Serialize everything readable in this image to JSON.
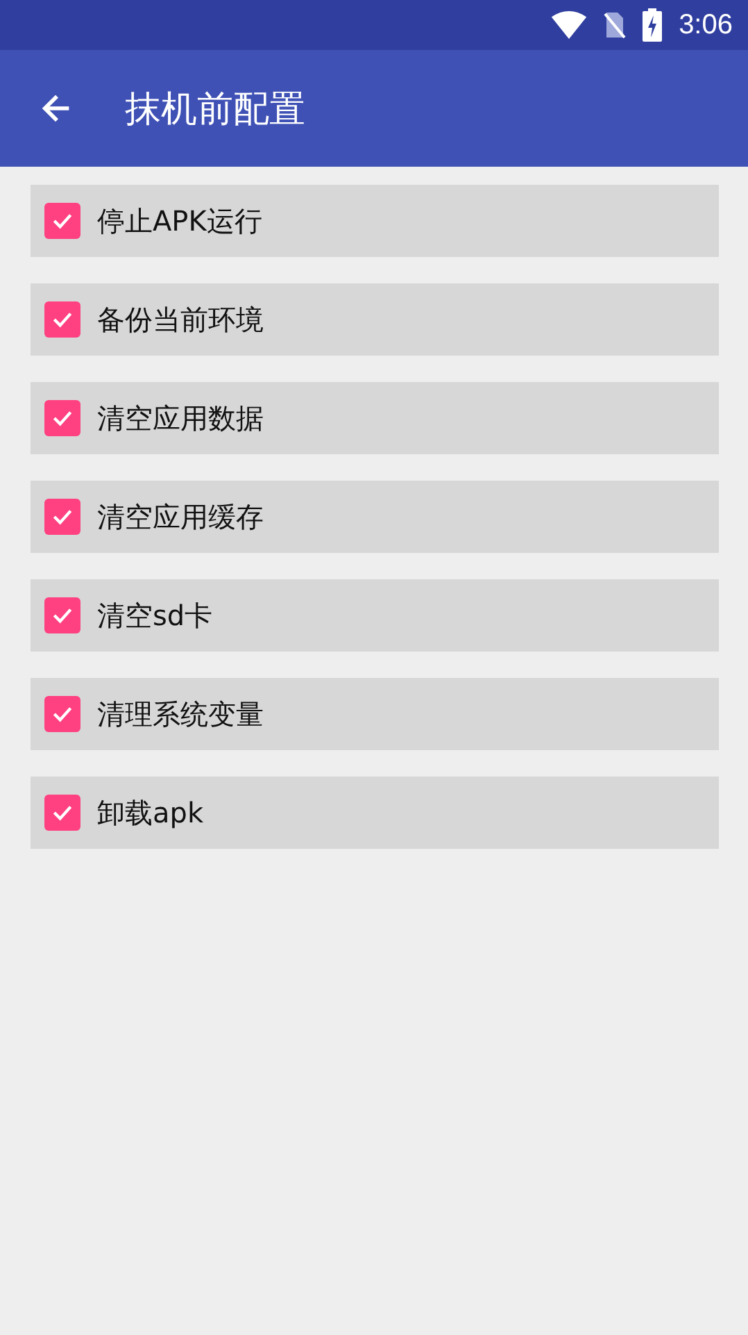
{
  "status_bar": {
    "time": "3:06"
  },
  "app_bar": {
    "title": "抹机前配置"
  },
  "options": [
    {
      "label": "停止APK运行",
      "checked": true
    },
    {
      "label": "备份当前环境",
      "checked": true
    },
    {
      "label": "清空应用数据",
      "checked": true
    },
    {
      "label": "清空应用缓存",
      "checked": true
    },
    {
      "label": "清空sd卡",
      "checked": true
    },
    {
      "label": "清理系统变量",
      "checked": true
    },
    {
      "label": "卸载apk",
      "checked": true
    }
  ]
}
